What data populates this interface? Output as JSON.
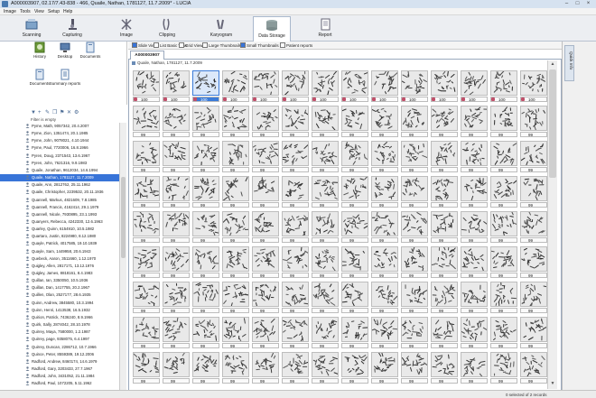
{
  "window": {
    "title": "A000003907, 02.17/7.43-838 - 466, Quaile, Nathan, 1781127, 11.7.2009* - LUCIA"
  },
  "menu": [
    "Image",
    "Tools",
    "View",
    "Setup",
    "Help"
  ],
  "ribbon_tabs": [
    {
      "label": "Scanning",
      "icon": "scanner-icon"
    },
    {
      "label": "Capturing",
      "icon": "microscope-icon"
    },
    {
      "label": "Image",
      "icon": "image-icon"
    },
    {
      "label": "Clipping",
      "icon": "clip-icon"
    },
    {
      "label": "Karyogram",
      "icon": "karyogram-icon"
    },
    {
      "label": "Data Storage",
      "icon": "database-icon",
      "active": true
    },
    {
      "label": "Report",
      "icon": "report-icon"
    }
  ],
  "tools": [
    {
      "label": "History",
      "icon": "history-icon"
    },
    {
      "label": "Desktop",
      "icon": "desktop-icon"
    },
    {
      "label": "Documents",
      "icon": "documents-icon"
    },
    {
      "label": "Documents",
      "icon": "documents-icon"
    },
    {
      "label": "Summary reports",
      "icon": "summary-report-icon"
    }
  ],
  "filter_text": "Filter is empty",
  "patients": [
    "Pyme, Math, 9057342, 20.4.2007",
    "Pyme, Zion, 1351474, 20.1.1985",
    "Pyme, John, 9078021, 4.10.1944",
    "Pyme, Paul, 7720006, 16.8.1966",
    "Pyren, Doug, 2371543, 13.6.1967",
    "Pyren, John, 7621316, 9.9.1983",
    "Quaile, Jonathan, 9612034, 14.6.1994",
    "Quaile, Nathan, 1781127, 11.7.2009",
    "Quaile, Ann, 2812762, 25.11.1962",
    "Quaile, Christopher, 2239532, 20.11.1936",
    "Quannell, Markus, 4821609, 7.8.1985",
    "Quannell, Francis, 4162414, 29.1.1979",
    "Quannell, Nicole, 7930895, 23.1.1993",
    "Quanyers, Rebecca, 4242330, 12.6.1963",
    "Quarley, Quinn, 6154910, 10.5.1982",
    "Quartaro, Justin, 8224980, 8.12.1980",
    "Quayle, Patrick, 4017585, 19.10.1939",
    "Quayle, Sam, 1449958, 20.6.1943",
    "Quebeck, Aaron, 3511660, 1.12.1970",
    "Quigley, Allen, 2817171, 13.12.1976",
    "Quigley, James, 8818161, 8.4.1983",
    "Quillan, Ian, 3350050, 10.5.1936",
    "Quillan, Dan, 1417755, 20.2.1967",
    "Quillen, Olan, 2527177, 28.6.1935",
    "Quinn, Andrew, 3845580, 10.3.1994",
    "Quinn, Henri, 1413538, 16.5.1932",
    "Quirion, Patrick, 7436240, 8.9.1966",
    "Quirk, Sally, 2874042, 28.10.1978",
    "Quirrey, Maya, 7580000, 1.2.1987",
    "Quirrey, page, 9358075, 6.4.1997",
    "Quirrey, Duncan, 2286712, 10.7.1966",
    "Quince, Peter, 8559389, 19.12.2006",
    "Radford, Andrew, 8460174, 14.6.1979",
    "Radford, Gary, 3203433, 27.7.1967",
    "Radford, John, 3431052, 21.11.1984",
    "Radford, Paul, 1072205, 5.11.1962"
  ],
  "selected_patient_index": 7,
  "view_options": [
    {
      "label": "Slide View",
      "checked": true
    },
    {
      "label": "List Basic View",
      "checked": false
    },
    {
      "label": "Grid View",
      "checked": false
    },
    {
      "label": "Large Thumbnails",
      "checked": false
    },
    {
      "label": "Small Thumbnails",
      "checked": true
    },
    {
      "label": "Patient reports",
      "checked": false
    }
  ],
  "case_tab": "A000003907",
  "case_header": "Quaile, Nathan, 1781127, 11.7.2009",
  "grid": {
    "columns": 14,
    "rows": 9,
    "first_row_score": "100",
    "other_score": "99",
    "selected_cell": [
      0,
      2
    ]
  },
  "right_panel_tab": "Quick Info",
  "status": "0 selected of 2 records"
}
